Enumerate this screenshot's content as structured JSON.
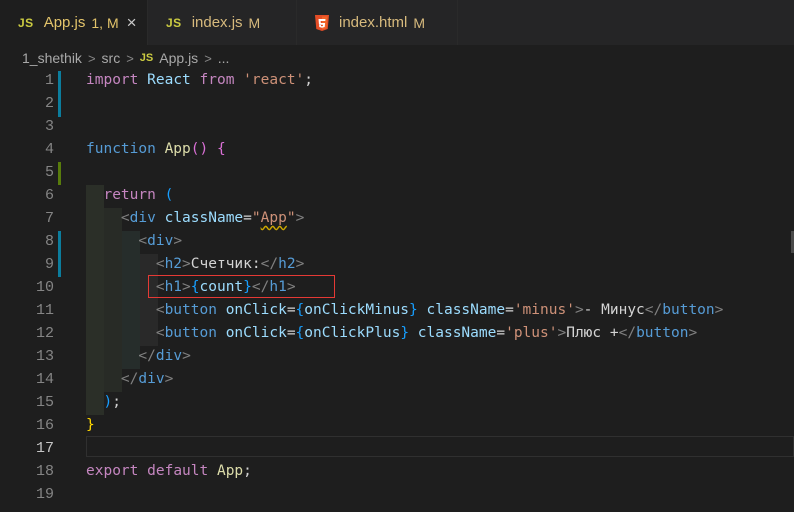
{
  "tabs": [
    {
      "icon": "JS",
      "name": "App.js",
      "status": "1, M",
      "close": "×"
    },
    {
      "icon": "JS",
      "name": "index.js",
      "status": "M"
    },
    {
      "icon": "html5-icon",
      "name": "index.html",
      "status": "M"
    }
  ],
  "breadcrumb": {
    "folder": "1_shethik",
    "subfolder": "src",
    "file_icon": "JS",
    "file": "App.js",
    "more": "..."
  },
  "editor": {
    "current_line": 17,
    "line_numbers": [
      "1",
      "2",
      "3",
      "4",
      "5",
      "6",
      "7",
      "8",
      "9",
      "10",
      "11",
      "12",
      "13",
      "14",
      "15",
      "16",
      "17",
      "18",
      "19"
    ],
    "lines": {
      "l1": {
        "import": "import",
        "react_name": "React",
        "from": "from",
        "module": "'react'",
        "semi": ";"
      },
      "l4": {
        "function": "function",
        "name": "App",
        "parens": "()",
        "brace": "{"
      },
      "l6": {
        "return": "return",
        "paren": "("
      },
      "l7": {
        "open": "<",
        "tag": "div",
        "attr": "className",
        "eq": "=",
        "q1": "\"",
        "val": "App",
        "q2": "\"",
        "close": ">"
      },
      "l8": {
        "open": "<",
        "tag": "div",
        "close": ">"
      },
      "l9": {
        "open": "<",
        "tag": "h2",
        "close": ">",
        "text": "Счетчик:",
        "end_open": "</",
        "end_tag": "h2",
        "end_close": ">"
      },
      "l10": {
        "open": "<",
        "tag": "h1",
        "close": ">",
        "lb": "{",
        "var": "count",
        "rb": "}",
        "end_open": "</",
        "end_tag": "h1",
        "end_close": ">"
      },
      "l11": {
        "open": "<",
        "tag": "button",
        "attr1": "onClick",
        "eq1": "=",
        "lb": "{",
        "handler": "onClickMinus",
        "rb": "}",
        "attr2": "className",
        "eq2": "=",
        "val": "'minus'",
        "close": ">",
        "text": "- Минус",
        "end_open": "</",
        "end_tag": "button",
        "end_close": ">"
      },
      "l12": {
        "open": "<",
        "tag": "button",
        "attr1": "onClick",
        "eq1": "=",
        "lb": "{",
        "handler": "onClickPlus",
        "rb": "}",
        "attr2": "className",
        "eq2": "=",
        "val": "'plus'",
        "close": ">",
        "text": "Плюс +",
        "end_open": "</",
        "end_tag": "button",
        "end_close": ">"
      },
      "l13": {
        "end_open": "</",
        "tag": "div",
        "close": ">"
      },
      "l14": {
        "end_open": "</",
        "tag": "div",
        "close": ">"
      },
      "l15": {
        "paren": ")",
        "semi": ";"
      },
      "l16": {
        "brace": "}"
      },
      "l18": {
        "export": "export",
        "default": "default",
        "name": "App",
        "semi": ";"
      }
    }
  },
  "colors": {
    "background": "#1e1e1e",
    "tabbar": "#252526",
    "highlight_box": "#e53935",
    "modified_indicator": "#0c7d9d",
    "added_indicator": "#587c0c"
  }
}
